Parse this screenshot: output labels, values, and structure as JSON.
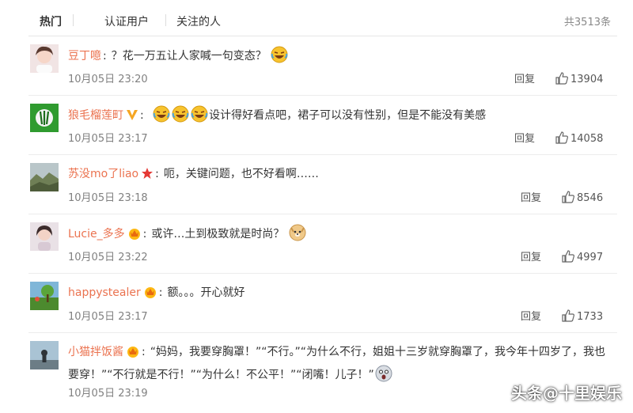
{
  "filters": {
    "hot": "热门",
    "verified": "认证用户",
    "followed": "关注的人",
    "total": "共3513条"
  },
  "actions": {
    "reply": "回复"
  },
  "comments": [
    {
      "user": "豆丁噫",
      "text_pre": "？花一万五让人家喊一句变态？",
      "text_post": "",
      "emojis": [
        "laughing-tears-emoji"
      ],
      "time": "10月05日 23:20",
      "likes": "13904"
    },
    {
      "user": "狼毛榴莲町",
      "badge": "gold-v-badge",
      "text_pre": "",
      "text_post": "设计得好看点吧，裙子可以没有性别，但是不能没有美感",
      "emojis": [
        "laughing-tears-emoji",
        "laughing-tears-emoji",
        "laughing-tears-emoji"
      ],
      "time": "10月05日 23:17",
      "likes": "14058"
    },
    {
      "user": "苏没mo了liao",
      "badge": "red-star-badge",
      "text_pre": "呃，关键问题，也不好看啊……",
      "text_post": "",
      "time": "10月05日 23:18",
      "likes": "8546"
    },
    {
      "user": "Lucie_多多",
      "badge": "crown-badge",
      "text_pre": "或许…土到极致就是时尚？",
      "text_post": "",
      "emojis": [
        "doge-emoji"
      ],
      "time": "10月05日 23:22",
      "likes": "4997"
    },
    {
      "user": "happystealer",
      "badge": "crown-badge",
      "text_pre": "额。。。开心就好",
      "text_post": "",
      "time": "10月05日 23:17",
      "likes": "1733"
    },
    {
      "user": "小猫拌饭酱",
      "badge": "crown-badge",
      "text_pre": "“妈妈，我要穿胸罩！”“不行。”“为什么不行，姐姐十三岁就穿胸罩了，我今年十四岁了，我也要穿！”“不行就是不行！”“为什么！不公平！”“闭嘴！儿子！”",
      "text_post": "",
      "emojis": [
        "shocked-face-emoji"
      ],
      "time": "10月05日 23:19",
      "likes": ""
    }
  ],
  "watermark": "头条@十里娱乐",
  "colors": {
    "username": "#eb7350",
    "time": "#808080",
    "divider": "#ececec"
  }
}
